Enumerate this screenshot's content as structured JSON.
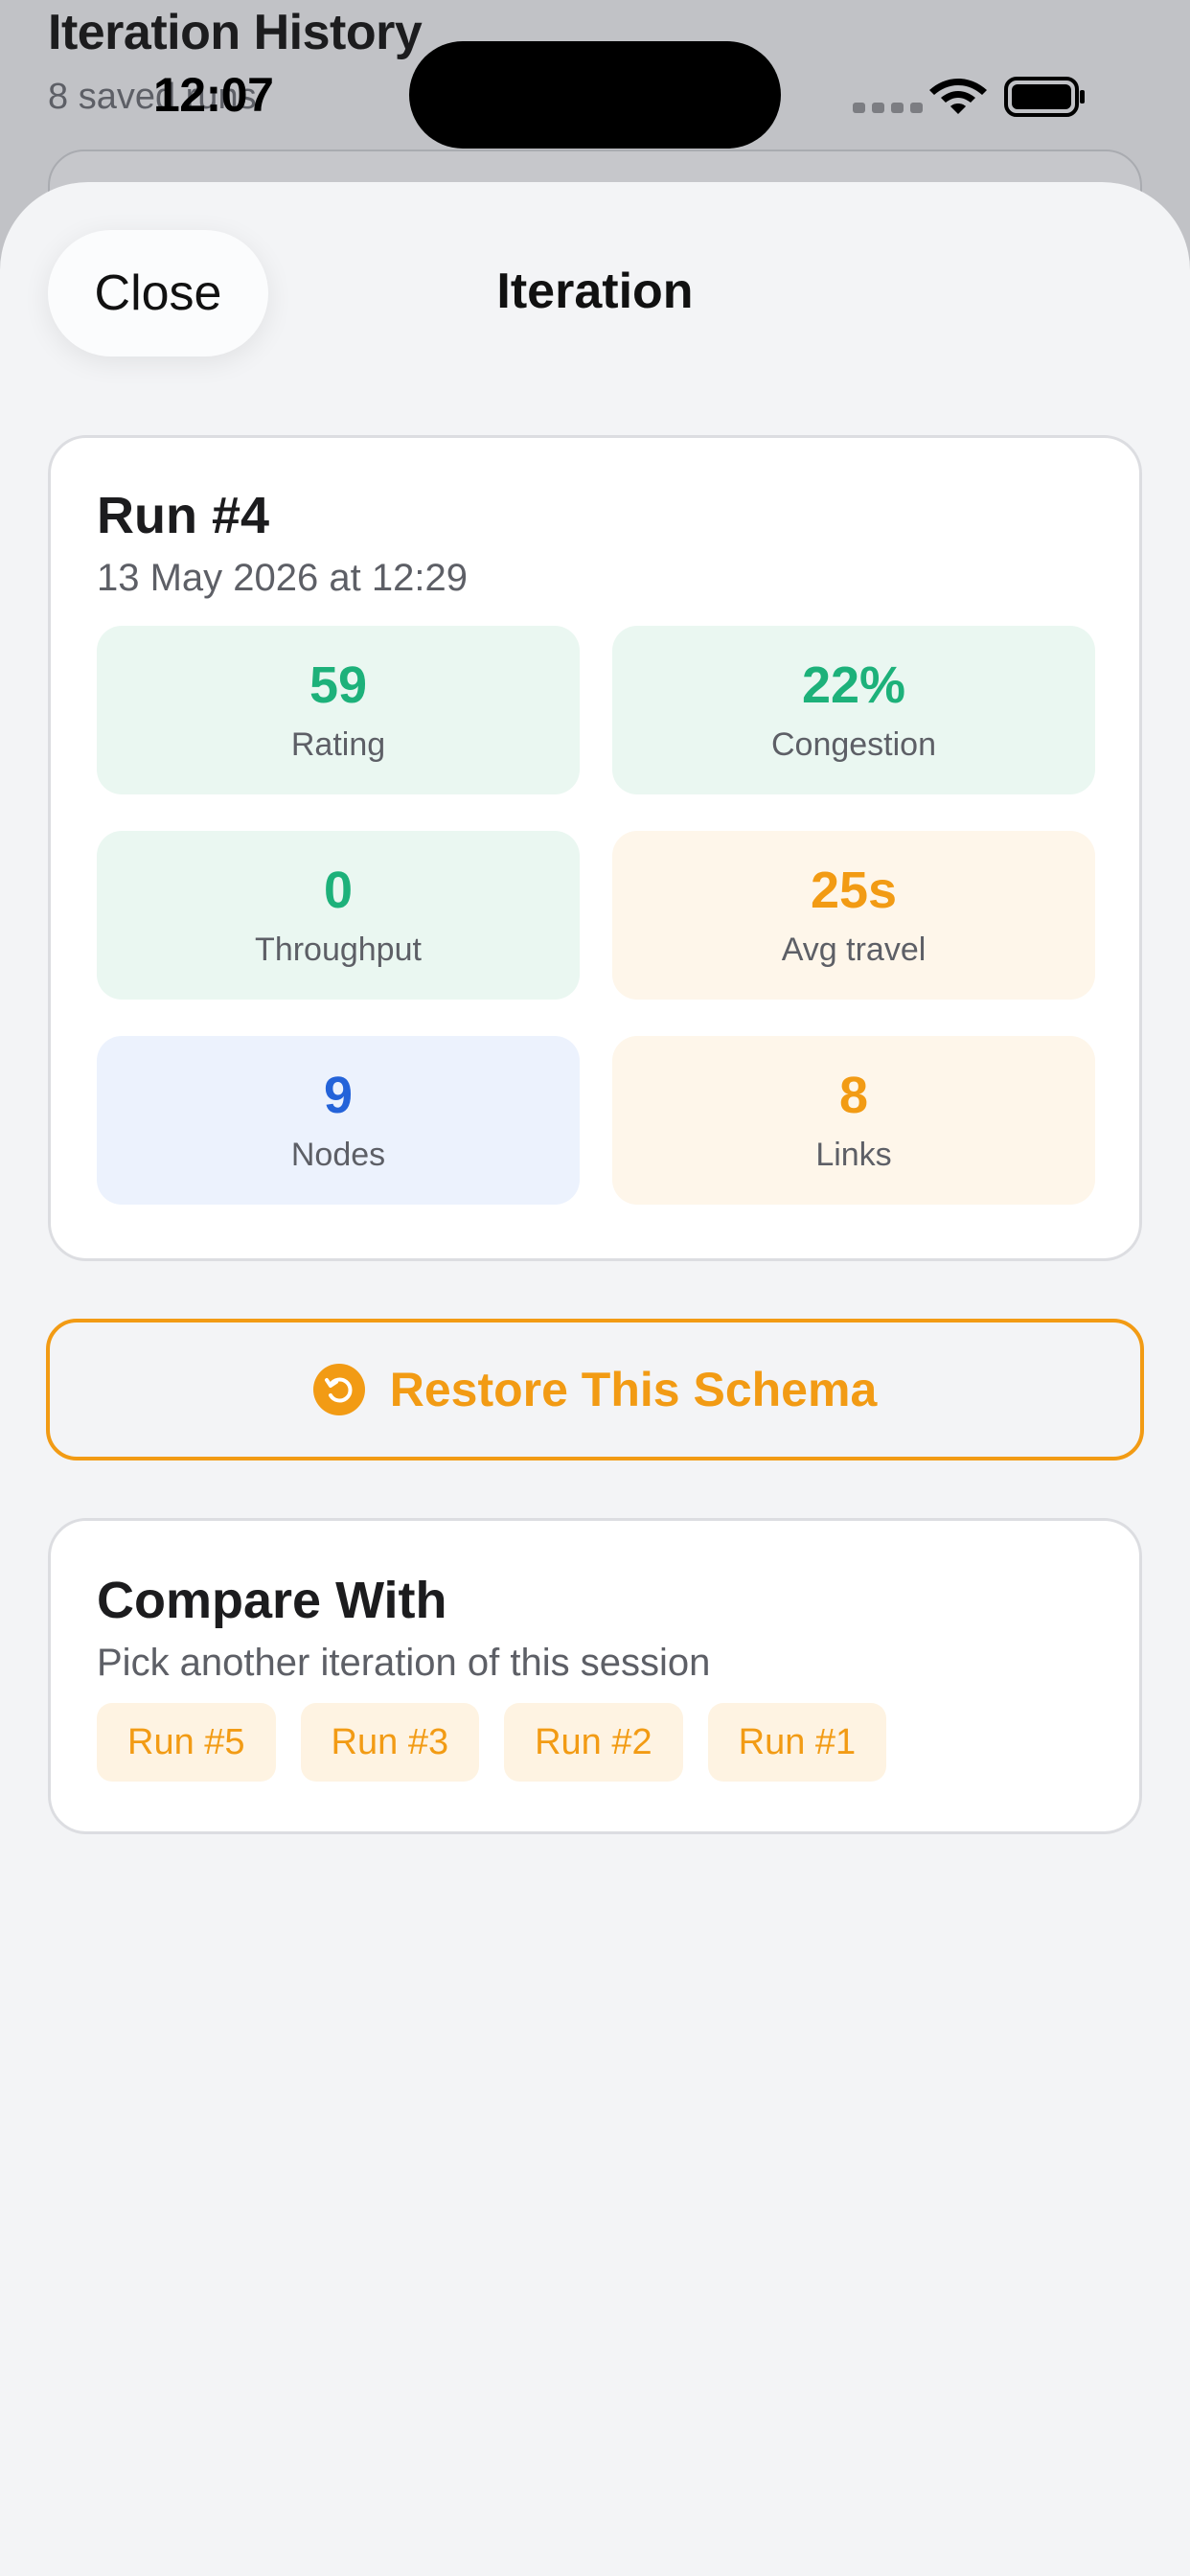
{
  "background": {
    "title": "Iteration History",
    "subtitle": "8 saved runs"
  },
  "status_bar": {
    "time": "12:07",
    "icons": [
      "signal-icon",
      "wifi-icon",
      "battery-icon"
    ]
  },
  "sheet": {
    "close_label": "Close",
    "title": "Iteration"
  },
  "run": {
    "title": "Run #4",
    "date": "13 May 2026 at 12:29",
    "stats": [
      {
        "value": "59",
        "label": "Rating",
        "tone": "green"
      },
      {
        "value": "22%",
        "label": "Congestion",
        "tone": "green"
      },
      {
        "value": "0",
        "label": "Throughput",
        "tone": "green"
      },
      {
        "value": "25s",
        "label": "Avg travel",
        "tone": "orange"
      },
      {
        "value": "9",
        "label": "Nodes",
        "tone": "blue"
      },
      {
        "value": "8",
        "label": "Links",
        "tone": "orange"
      }
    ]
  },
  "restore": {
    "label": "Restore This Schema",
    "icon": "restore-icon"
  },
  "compare": {
    "title": "Compare With",
    "subtitle": "Pick another iteration of this session",
    "options": [
      "Run #5",
      "Run #3",
      "Run #2",
      "Run #1"
    ]
  },
  "colors": {
    "accent_orange": "#f29b14",
    "green": "#1db17a",
    "blue": "#2463d9",
    "sheet_background": "#f3f4f6"
  }
}
